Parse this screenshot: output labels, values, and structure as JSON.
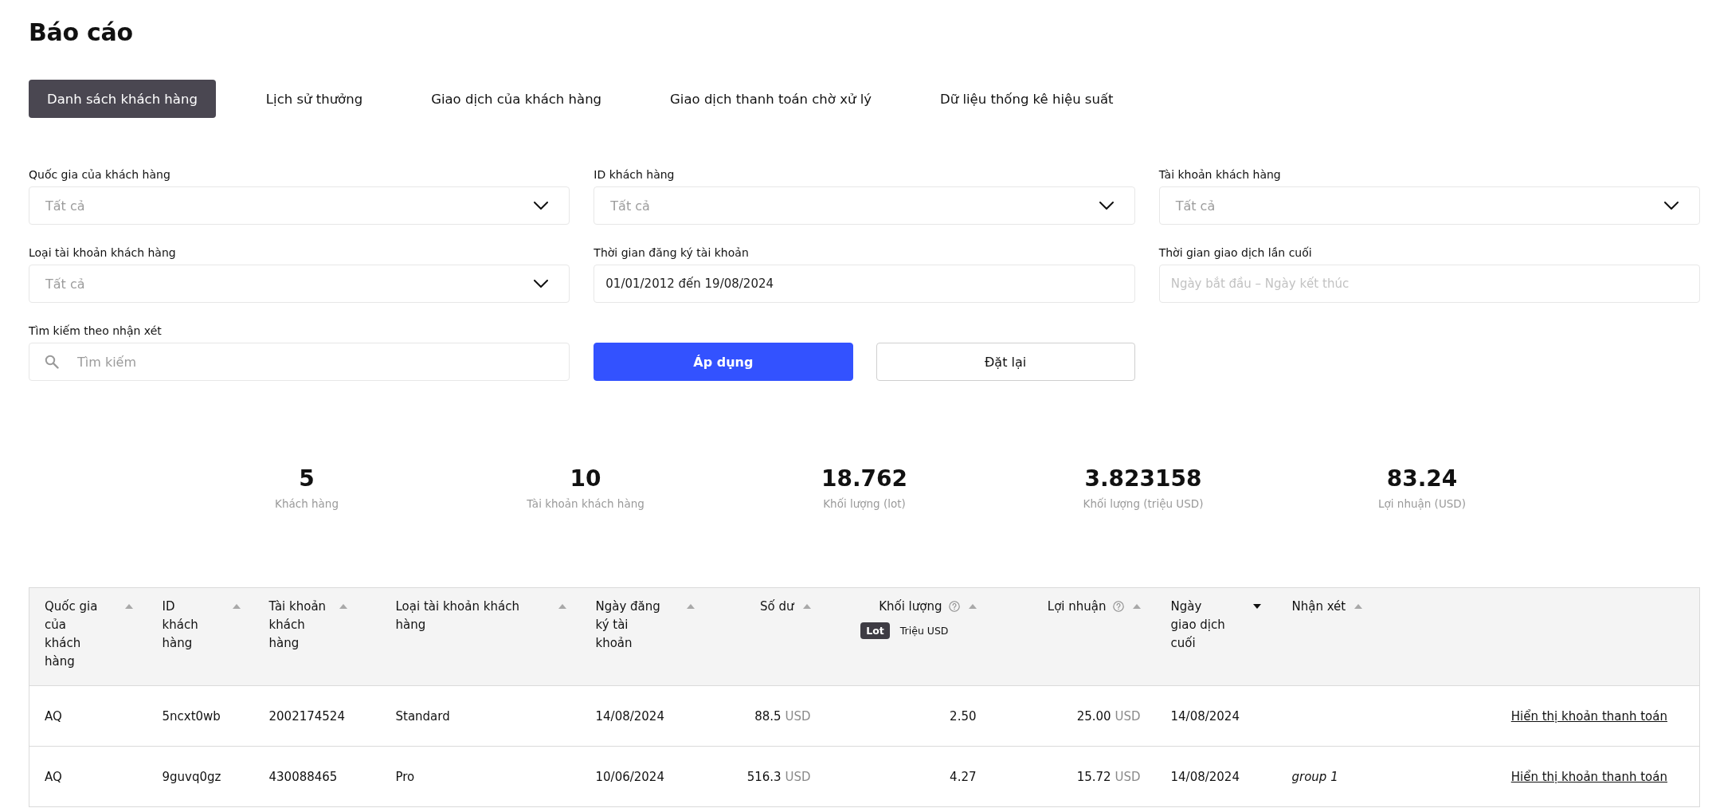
{
  "page_title": "Báo cáo",
  "tabs": [
    {
      "label": "Danh sách khách hàng",
      "selected": true
    },
    {
      "label": "Lịch sử thưởng",
      "selected": false
    },
    {
      "label": "Giao dịch của khách hàng",
      "selected": false
    },
    {
      "label": "Giao dịch thanh toán chờ xử lý",
      "selected": false
    },
    {
      "label": "Dữ liệu thống kê hiệu suất",
      "selected": false
    }
  ],
  "filters": [
    {
      "kind": "select",
      "label": "Quốc gia của khách hàng",
      "placeholder": "Tất cả"
    },
    {
      "kind": "select",
      "label": "ID khách hàng",
      "placeholder": "Tất cả"
    },
    {
      "kind": "select",
      "label": "Tài khoản khách hàng",
      "placeholder": "Tất cả"
    },
    {
      "kind": "select",
      "label": "Loại tài khoản khách hàng",
      "placeholder": "Tất cả"
    },
    {
      "kind": "date_range",
      "label": "Thời gian đăng ký tài khoản",
      "value": "01/01/2012 đến 19/08/2024"
    },
    {
      "kind": "date_range",
      "label": "Thời gian giao dịch lần cuối",
      "placeholder": "Ngày bắt đầu – Ngày kết thúc"
    },
    {
      "kind": "search",
      "label": "Tìm kiếm theo nhận xét",
      "placeholder": "Tìm kiếm"
    }
  ],
  "actions": [
    {
      "kind": "primary",
      "label": "Áp dụng"
    },
    {
      "kind": "secondary",
      "label": "Đặt lại"
    }
  ],
  "summary": [
    {
      "value": "5",
      "label": "Khách hàng"
    },
    {
      "value": "10",
      "label": "Tài khoản khách hàng"
    },
    {
      "value": "18.762",
      "label": "Khối lượng (lot)"
    },
    {
      "value": "3.823158",
      "label": "Khối lượng (triệu USD)"
    },
    {
      "value": "83.24",
      "label": "Lợi nhuận (USD)"
    }
  ],
  "table": {
    "columns": [
      {
        "label": "Quốc gia của khách hàng",
        "sorted": false,
        "descending": false
      },
      {
        "label": "ID khách hàng",
        "sorted": false,
        "descending": false
      },
      {
        "label": "Tài khoản khách hàng",
        "sorted": false,
        "descending": false
      },
      {
        "label": "Loại tài khoản khách hàng",
        "sorted": false,
        "descending": false
      },
      {
        "label": "Ngày đăng ký tài khoản",
        "sorted": false,
        "descending": false
      },
      {
        "label": "Số dư",
        "sorted": false,
        "descending": false
      },
      {
        "label": "Khối lượng",
        "sorted": false,
        "descending": false,
        "help_icon": true,
        "unit_toggle": [
          {
            "label": "Lot",
            "selected": true
          },
          {
            "label": "Triệu USD",
            "selected": false
          }
        ]
      },
      {
        "label": "Lợi nhuận",
        "sorted": false,
        "descending": false,
        "help_icon": true
      },
      {
        "label": "Ngày giao dịch cuối",
        "sorted": true,
        "descending": true
      },
      {
        "label": "Nhận xét",
        "sorted": false,
        "descending": false
      }
    ],
    "rows": [
      {
        "country": "AQ",
        "customer_id": "5ncxt0wb",
        "account": "2002174524",
        "account_type": "Standard",
        "registered": "14/08/2024",
        "balance": {
          "amount": "88.5",
          "currency": "USD"
        },
        "volume": "2.50",
        "profit": {
          "amount": "25.00",
          "currency": "USD"
        },
        "last_trade": "14/08/2024",
        "payments_link": "Hiển thị khoản thanh toán"
      },
      {
        "country": "AQ",
        "customer_id": "9guvq0gz",
        "account": "430088465",
        "account_type": "Pro",
        "registered": "10/06/2024",
        "balance": {
          "amount": "516.3",
          "currency": "USD"
        },
        "volume": "4.27",
        "profit": {
          "amount": "15.72",
          "currency": "USD"
        },
        "last_trade": "14/08/2024",
        "comment": "group 1",
        "payments_link": "Hiển thị khoản thanh toán"
      }
    ]
  }
}
